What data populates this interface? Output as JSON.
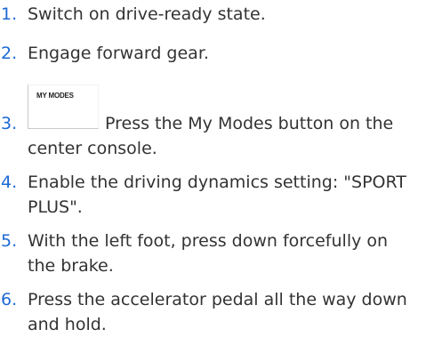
{
  "steps": [
    {
      "num": "1.",
      "text": "Switch on drive-ready state."
    },
    {
      "num": "2.",
      "text": "Engage forward gear."
    },
    {
      "num": "3.",
      "text": "Press the My Modes button on the center console.",
      "button_label": "MY MODES"
    },
    {
      "num": "4.",
      "text": "Enable the driving dynamics setting: \"SPORT PLUS\"."
    },
    {
      "num": "5.",
      "text": "With the left foot, press down forcefully on the brake."
    },
    {
      "num": "6.",
      "text": "Press the accelerator pedal all the way down and hold."
    }
  ],
  "colors": {
    "number": "#1c69d4",
    "text": "#333333"
  }
}
